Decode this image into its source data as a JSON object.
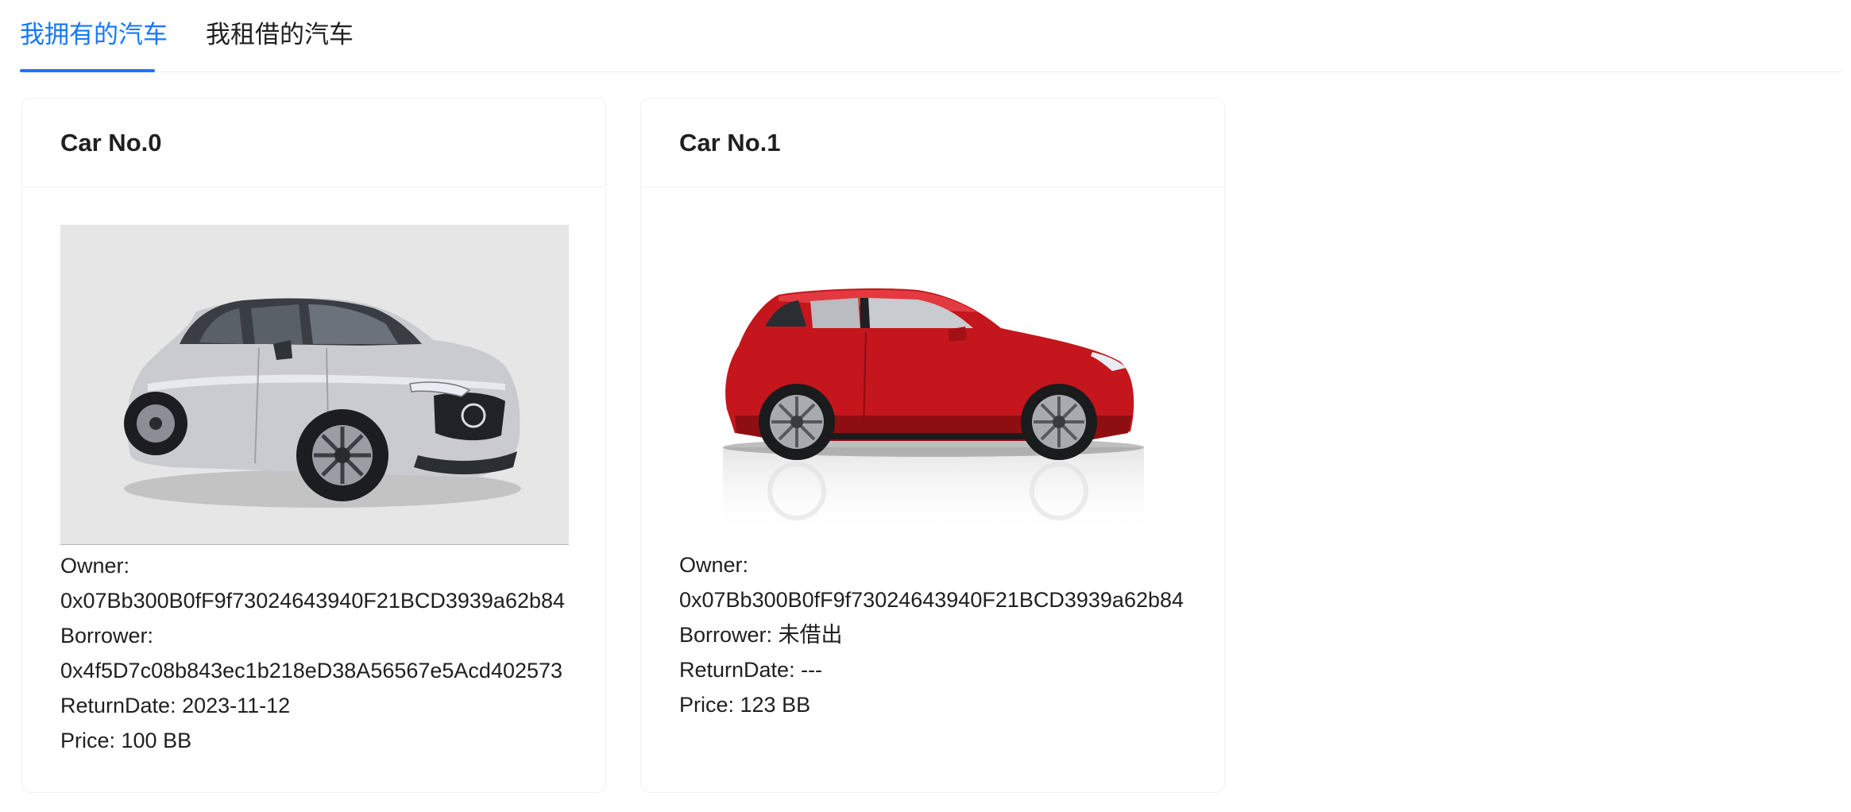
{
  "tabs": [
    {
      "label": "我拥有的汽车",
      "active": true
    },
    {
      "label": "我租借的汽车",
      "active": false
    }
  ],
  "colors": {
    "accent": "#1677ff",
    "border": "#f0f0f0",
    "car0_body": "#c7c9cf",
    "car1_body": "#c4161c"
  },
  "cards": [
    {
      "title": "Car No.0",
      "image_icon": "silver-sedan-car-photo",
      "owner_label": "Owner:",
      "owner_value": "0x07Bb300B0fF9f73024643940F21BCD3939a62b84",
      "borrower_label": "Borrower:",
      "borrower_value": "0x4f5D7c08b843ec1b218eD38A56567e5Acd402573",
      "return_date": "ReturnDate: 2023-11-12",
      "price": "Price: 100 BB"
    },
    {
      "title": "Car No.1",
      "image_icon": "red-hatchback-car-photo",
      "owner_label": "Owner:",
      "owner_value": "0x07Bb300B0fF9f73024643940F21BCD3939a62b84",
      "borrower_line": "Borrower: 未借出",
      "return_date": "ReturnDate: ---",
      "price": "Price: 123 BB"
    }
  ]
}
